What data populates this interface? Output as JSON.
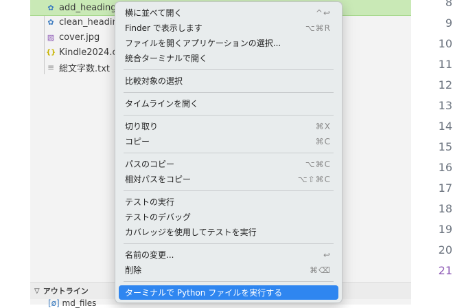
{
  "explorer": {
    "files": [
      {
        "name": "add_heading_",
        "icon": "python-file-icon",
        "selected": true
      },
      {
        "name": "clean_headin",
        "icon": "python-file-icon"
      },
      {
        "name": "cover.jpg",
        "icon": "image-file-icon"
      },
      {
        "name": "Kindle2024.c",
        "icon": "json-file-icon"
      },
      {
        "name": "総文字数.txt",
        "icon": "text-file-icon"
      }
    ],
    "outline_header": "アウトライン",
    "outline_item": "md_files"
  },
  "line_numbers": [
    "8",
    "9",
    "10",
    "11",
    "12",
    "13",
    "14",
    "15",
    "16",
    "17",
    "18",
    "19",
    "20",
    "21"
  ],
  "active_line": "21",
  "context_menu": {
    "items": [
      {
        "label": "横に並べて開く",
        "shortcut": "^↩"
      },
      {
        "label": "Finder で表示します",
        "shortcut": "⌥⌘R"
      },
      {
        "label": "ファイルを開くアプリケーションの選択...",
        "shortcut": ""
      },
      {
        "label": "統合ターミナルで開く",
        "shortcut": ""
      },
      {
        "label": "比較対象の選択",
        "shortcut": ""
      },
      {
        "label": "タイムラインを開く",
        "shortcut": ""
      },
      {
        "label": "切り取り",
        "shortcut": "⌘X"
      },
      {
        "label": "コピー",
        "shortcut": "⌘C"
      },
      {
        "label": "パスのコピー",
        "shortcut": "⌥⌘C"
      },
      {
        "label": "相対パスをコピー",
        "shortcut": "⌥⇧⌘C"
      },
      {
        "label": "テストの実行",
        "shortcut": ""
      },
      {
        "label": "テストのデバッグ",
        "shortcut": ""
      },
      {
        "label": "カバレッジを使用してテストを実行",
        "shortcut": ""
      },
      {
        "label": "名前の変更...",
        "shortcut": "↩"
      },
      {
        "label": "削除",
        "shortcut": "⌘⌫"
      },
      {
        "label": "ターミナルで Python ファイルを実行する",
        "shortcut": ""
      }
    ]
  },
  "colors": {
    "selection_bg": "#c9e9b6",
    "menu_highlight": "#2f86f0",
    "active_line_number": "#8e5ab6"
  }
}
